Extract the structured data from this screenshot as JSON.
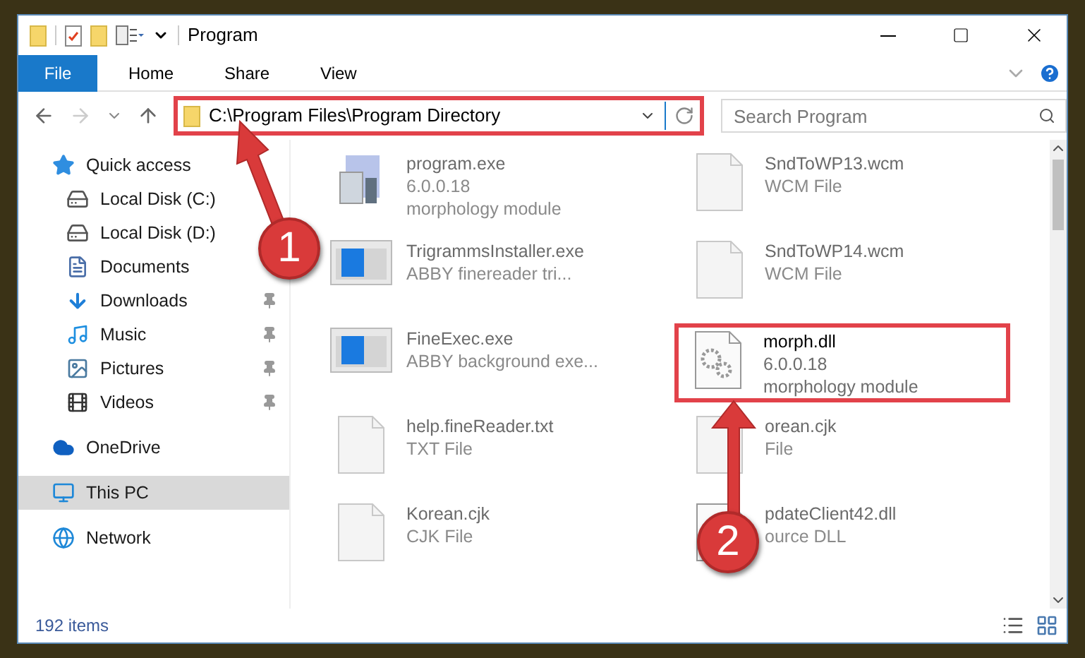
{
  "window": {
    "title": "Program"
  },
  "ribbon_tabs": [
    {
      "label": "File",
      "selected": true
    },
    {
      "label": "Home",
      "selected": false
    },
    {
      "label": "Share",
      "selected": false
    },
    {
      "label": "View",
      "selected": false
    }
  ],
  "address": {
    "path": "C:\\Program Files\\Program Directory",
    "highlighted": true
  },
  "search": {
    "placeholder": "Search Program"
  },
  "sidebar": {
    "items": [
      {
        "label": "Quick access",
        "selected": false,
        "children": [
          {
            "label": "Local Disk (C:)",
            "pinned": false,
            "selected": false
          },
          {
            "label": "Local Disk (D:)",
            "pinned": false,
            "selected": false
          },
          {
            "label": "Documents",
            "pinned": false,
            "selected": false
          },
          {
            "label": "Downloads",
            "pinned": true,
            "selected": false
          },
          {
            "label": "Music",
            "pinned": true,
            "selected": false
          },
          {
            "label": "Pictures",
            "pinned": true,
            "selected": false
          },
          {
            "label": "Videos",
            "pinned": true,
            "selected": false
          }
        ]
      },
      {
        "label": "OneDrive",
        "selected": false
      },
      {
        "label": "This PC",
        "selected": true
      },
      {
        "label": "Network",
        "selected": false
      }
    ]
  },
  "files": [
    {
      "name": "program.exe",
      "lines": [
        "6.0.0.18",
        "morphology module"
      ],
      "kind": "setup",
      "highlighted": false
    },
    {
      "name": "SndToWP13.wcm",
      "lines": [
        "WCM File"
      ],
      "kind": "page",
      "highlighted": false
    },
    {
      "name": "TrigrammsInstaller.exe",
      "lines": [
        "ABBY finereader tri..."
      ],
      "kind": "app",
      "highlighted": false
    },
    {
      "name": "SndToWP14.wcm",
      "lines": [
        "WCM File"
      ],
      "kind": "page",
      "highlighted": false
    },
    {
      "name": "FineExec.exe",
      "lines": [
        "ABBY background exe..."
      ],
      "kind": "app",
      "highlighted": false
    },
    {
      "name": "morph.dll",
      "lines": [
        "6.0.0.18",
        "morphology module"
      ],
      "kind": "gears",
      "highlighted": true
    },
    {
      "name": "help.fineReader.txt",
      "lines": [
        "TXT File"
      ],
      "kind": "page",
      "highlighted": false
    },
    {
      "name": "orean.cjk",
      "lines": [
        "File"
      ],
      "kind": "page",
      "highlighted": false
    },
    {
      "name": "Korean.cjk",
      "lines": [
        "CJK File"
      ],
      "kind": "page",
      "highlighted": false
    },
    {
      "name": "pdateClient42.dll",
      "lines": [
        "ource DLL"
      ],
      "kind": "gears",
      "highlighted": false
    }
  ],
  "status_bar": {
    "count": "192 items"
  },
  "annotations": [
    {
      "number": "1"
    },
    {
      "number": "2"
    }
  ]
}
